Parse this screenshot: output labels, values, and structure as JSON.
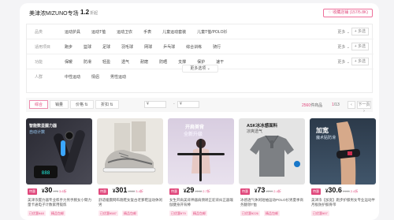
{
  "header": {
    "store_name": "美津浓MIZUNO专场",
    "score": "1.2",
    "score_unit": "折起",
    "fav_label": "♡ 收藏店铺 (157/5.8K)"
  },
  "filters": {
    "rows": [
      {
        "label": "品类",
        "options": [
          "运动护具",
          "运动T恤",
          "运动卫衣",
          "手表",
          "儿童运动套装",
          "儿童T恤/POLO衫"
        ]
      },
      {
        "label": "适用项目",
        "options": [
          "跑步",
          "篮球",
          "足球",
          "羽毛球",
          "网球",
          "乒乓球",
          "综合训练",
          "骑行"
        ]
      },
      {
        "label": "功能",
        "options": [
          "保暖",
          "防滑",
          "轻盈",
          "透气",
          "耐磨",
          "防晒",
          "支撑",
          "保护",
          "速干"
        ]
      },
      {
        "label": "人群",
        "options": [
          "中性运动",
          "情侣",
          "男性运动"
        ]
      }
    ],
    "more_label": "更多 ⌄",
    "multi_label": "+ 多选",
    "more_options_label": "更多选项 ⌄"
  },
  "toolbar": {
    "sort_default": "综合",
    "sort_sales": "销量",
    "sort_price": "价格 ⇅",
    "sort_discount": "折扣 ⇅",
    "price_min": "¥",
    "price_max": "¥",
    "dash": "-",
    "count_num": "2560",
    "count_unit": "件商品",
    "page_current": "1",
    "page_total": "/13",
    "prev_label": "‹",
    "next_label": "下一页 ›"
  },
  "products": [
    {
      "tag": "特惠",
      "price": "30",
      "orig": "¥78",
      "sales": "3.6折",
      "title": "美津浓握力器专业练手力男手腕女小臂力量卡通电子计数家用锻炼",
      "badges": [
        "已优惠¥48",
        "精品包邮"
      ],
      "thumb_line1": "智能数显握力器",
      "thumb_line2": "自动计数"
    },
    {
      "tag": "特惠",
      "price": "301",
      "orig": "¥888",
      "sales": "3.4折",
      "title": "舒适缓震网布跑鞋女复古老爹鞋运动休闲男",
      "badges": [
        "已优惠¥587",
        "精品包邮"
      ],
      "thumb_line1": "",
      "thumb_line2": ""
    },
    {
      "tag": "特惠",
      "price": "29",
      "orig": "¥108",
      "sales": "2.7折",
      "title": "女生开肩美背神器肩颈矫正驼背纠正器瑜伽健身开背棒",
      "badges": [
        "已优惠¥79",
        "精品包邮"
      ],
      "thumb_line1": "开肩美背",
      "thumb_line2": "全新升级"
    },
    {
      "tag": "特惠",
      "price": "73",
      "orig": "¥299",
      "sales": "2.4折",
      "title": "冰感透气休闲短袖运动POLO衫男夏季商务翻领T恤",
      "badges": [
        "已优惠¥226",
        "精品包邮"
      ],
      "thumb_line1": "ASK冰冰感面料",
      "thumb_line2": "凉爽透气"
    },
    {
      "tag": "特惠",
      "price": "30.6",
      "orig": "¥128",
      "sales": "2.4折",
      "title": "美津浓【加宽】跑步护膝男女专业运动半月板防护髌骨带",
      "badges": [
        "已优惠¥97"
      ],
      "thumb_line1": "加宽",
      "thumb_line2": "魔术贴防滑"
    }
  ],
  "colors": {
    "accent": "#e0487c"
  }
}
